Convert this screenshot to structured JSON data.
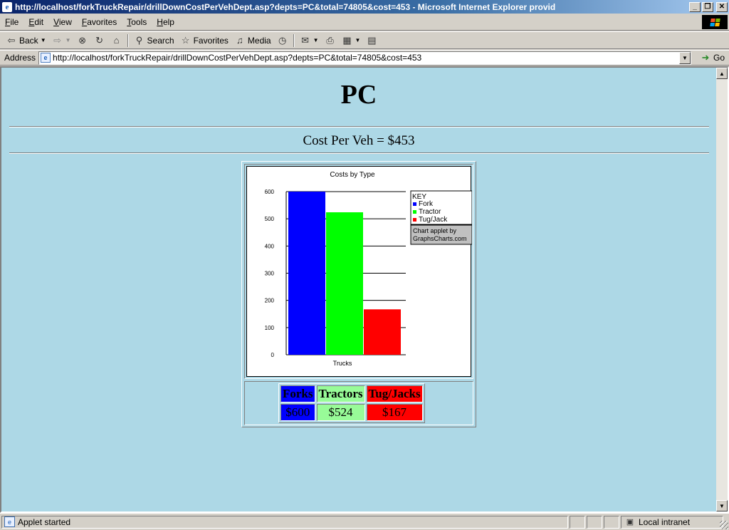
{
  "window": {
    "title": "http://localhost/forkTruckRepair/drillDownCostPerVehDept.asp?depts=PC&total=74805&cost=453 - Microsoft Internet Explorer provid"
  },
  "menu": {
    "items": [
      {
        "label": "File",
        "key": "F",
        "rest": "ile"
      },
      {
        "label": "Edit",
        "key": "E",
        "rest": "dit"
      },
      {
        "label": "View",
        "key": "V",
        "rest": "iew"
      },
      {
        "label": "Favorites",
        "key": "F",
        "rest": "avorites"
      },
      {
        "label": "Tools",
        "key": "T",
        "rest": "ools"
      },
      {
        "label": "Help",
        "key": "H",
        "rest": "elp"
      }
    ]
  },
  "toolbar": {
    "back_label": "Back",
    "search_label": "Search",
    "favorites_label": "Favorites",
    "media_label": "Media"
  },
  "address": {
    "label": "Address",
    "url": "http://localhost/forkTruckRepair/drillDownCostPerVehDept.asp?depts=PC&total=74805&cost=453",
    "go_label": "Go"
  },
  "page": {
    "title": "PC",
    "subtitle": "Cost Per Veh = $453",
    "background": "#add8e6"
  },
  "chart_data": {
    "type": "bar",
    "title": "Costs by Type",
    "xlabel": "Trucks",
    "ylabel": "",
    "categories": [
      "Trucks"
    ],
    "series": [
      {
        "name": "Fork",
        "values": [
          600
        ],
        "color": "#0000ff"
      },
      {
        "name": "Tractor",
        "values": [
          524
        ],
        "color": "#00ff00"
      },
      {
        "name": "Tug/Jack",
        "values": [
          167
        ],
        "color": "#ff0000"
      }
    ],
    "ylim": [
      0,
      600
    ],
    "yticks": [
      "0",
      "100",
      "200",
      "300",
      "400",
      "500",
      "600"
    ],
    "grid": true,
    "legend": {
      "title": "KEY",
      "placement": "top-right"
    },
    "credit": [
      "Chart applet by",
      "GraphsCharts.com"
    ]
  },
  "cost_table": {
    "headers": [
      "Forks",
      "Tractors",
      "Tug/Jacks"
    ],
    "values": [
      "$600",
      "$524",
      "$167"
    ],
    "colors": [
      "#0000ff",
      "#98fb98",
      "#ff0000"
    ]
  },
  "status": {
    "text": "Applet started",
    "zone": "Local intranet"
  }
}
